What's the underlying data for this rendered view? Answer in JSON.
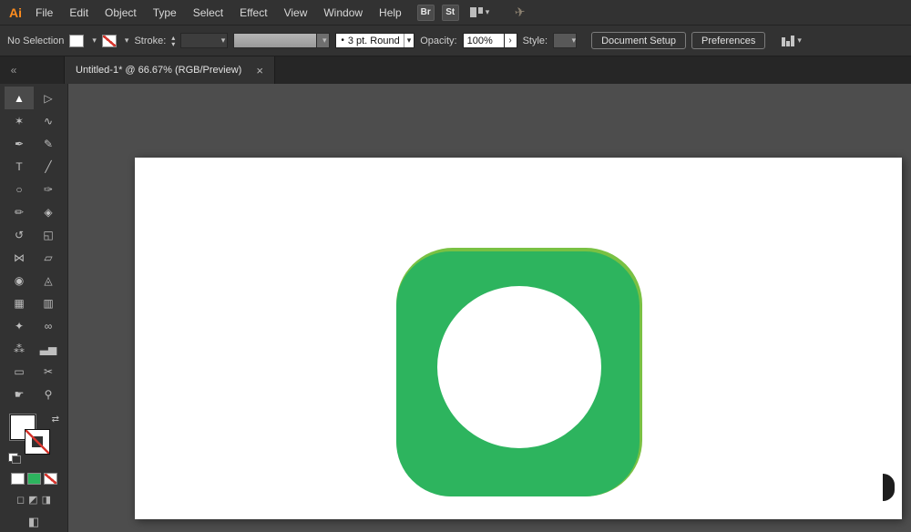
{
  "menubar": {
    "logo": "Ai",
    "items": [
      "File",
      "Edit",
      "Object",
      "Type",
      "Select",
      "Effect",
      "View",
      "Window",
      "Help"
    ],
    "br_button": "Br",
    "st_button": "St",
    "workspace_caret": "▾",
    "share_icon": "✈"
  },
  "controlbar": {
    "selection_status": "No Selection",
    "fill_caret": "▾",
    "stroke_swatch_caret": "▾",
    "stroke_label": "Stroke:",
    "stepper_up": "▴",
    "stepper_down": "▾",
    "weight_caret": "▾",
    "brush_caret": "▾",
    "brush_bullet": "•",
    "brush_value": "3 pt. Round",
    "brush_value_caret": "▾",
    "opacity_label": "Opacity:",
    "opacity_value": "100%",
    "opacity_arrow": "›",
    "style_label": "Style:",
    "style_caret": "▾",
    "document_setup_button": "Document Setup",
    "preferences_button": "Preferences",
    "align_caret": "▾"
  },
  "tabbar": {
    "collapse_icon": "«",
    "tab_title": "Untitled-1* @ 66.67% (RGB/Preview)",
    "close_icon": "×"
  },
  "toolbar": {
    "tools": [
      {
        "name": "selection-tool",
        "glyph": "▲",
        "selected": true
      },
      {
        "name": "direct-selection-tool",
        "glyph": "▷"
      },
      {
        "name": "magic-wand-tool",
        "glyph": "✶"
      },
      {
        "name": "lasso-tool",
        "glyph": "∿"
      },
      {
        "name": "pen-tool",
        "glyph": "✒"
      },
      {
        "name": "curvature-tool",
        "glyph": "✎"
      },
      {
        "name": "type-tool",
        "glyph": "T"
      },
      {
        "name": "line-segment-tool",
        "glyph": "╱"
      },
      {
        "name": "ellipse-tool",
        "glyph": "○"
      },
      {
        "name": "paintbrush-tool",
        "glyph": "✑"
      },
      {
        "name": "shaper-tool",
        "glyph": "✏"
      },
      {
        "name": "eraser-tool",
        "glyph": "◈"
      },
      {
        "name": "rotate-tool",
        "glyph": "↺"
      },
      {
        "name": "scale-tool",
        "glyph": "◱"
      },
      {
        "name": "width-tool",
        "glyph": "⋈"
      },
      {
        "name": "free-transform-tool",
        "glyph": "▱"
      },
      {
        "name": "shape-builder-tool",
        "glyph": "◉"
      },
      {
        "name": "perspective-grid-tool",
        "glyph": "◬"
      },
      {
        "name": "mesh-tool",
        "glyph": "▦"
      },
      {
        "name": "gradient-tool",
        "glyph": "▥"
      },
      {
        "name": "eyedropper-tool",
        "glyph": "✦"
      },
      {
        "name": "blend-tool",
        "glyph": "∞"
      },
      {
        "name": "symbol-sprayer-tool",
        "glyph": "⁂"
      },
      {
        "name": "column-graph-tool",
        "glyph": "▃▅"
      },
      {
        "name": "artboard-tool",
        "glyph": "▭"
      },
      {
        "name": "slice-tool",
        "glyph": "✂"
      },
      {
        "name": "hand-tool",
        "glyph": "☛"
      },
      {
        "name": "zoom-tool",
        "glyph": "⚲"
      }
    ],
    "swap_icon": "⇄",
    "draw_modes": [
      "◻",
      "◩",
      "◨"
    ],
    "screen_mode_icon": "◧",
    "swatch_green": "#2db45e"
  },
  "canvas": {
    "app_icon": {
      "edge_color": "#79c143",
      "main_color": "#2db45e",
      "circle_color": "#ffffff"
    },
    "fragment_color": "#1d1d1d"
  }
}
